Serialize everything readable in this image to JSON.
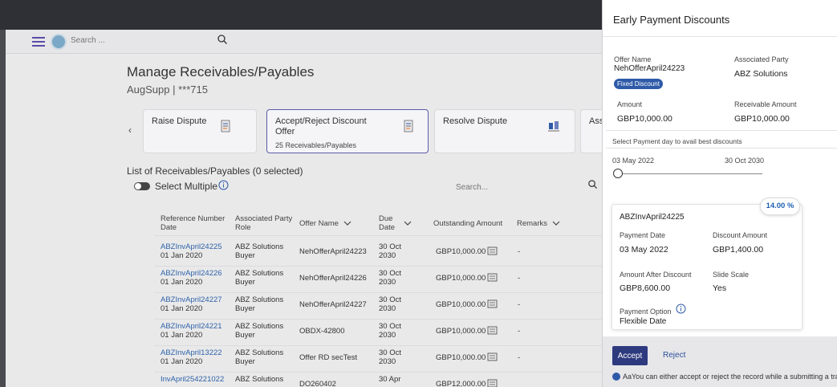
{
  "header": {
    "search_placeholder": "Search ..."
  },
  "page": {
    "title": "Manage Receivables/Payables",
    "subtitle": "AugSupp | ***715"
  },
  "carousel": {
    "cards": [
      {
        "title": "Raise Dispute",
        "count": ""
      },
      {
        "title": "Accept/Reject Discount Offer",
        "count": "25 Receivables/Payables"
      },
      {
        "title": "Resolve Dispute",
        "count": ""
      },
      {
        "title": "Assi",
        "count": ""
      }
    ]
  },
  "list": {
    "title": "List of Receivables/Payables (0 selected)",
    "select_multiple": "Select Multiple",
    "search_placeholder": "Search...",
    "columns": {
      "ref": [
        "Reference Number",
        "Date"
      ],
      "party": [
        "Associated Party",
        "Role"
      ],
      "offer": "Offer Name",
      "due": [
        "Due",
        "Date"
      ],
      "outstanding": "Outstanding Amount",
      "remarks": "Remarks"
    },
    "rows": [
      {
        "ref": "ABZInvApril24225",
        "date": "01 Jan 2020",
        "party": "ABZ Solutions",
        "role": "Buyer",
        "offer": "NehOfferApril24223",
        "due1": "30 Oct",
        "due2": "2030",
        "amount": "GBP10,000.00",
        "remarks": "-"
      },
      {
        "ref": "ABZInvApril24226",
        "date": "01 Jan 2020",
        "party": "ABZ Solutions",
        "role": "Buyer",
        "offer": "NehOfferApril24226",
        "due1": "30 Oct",
        "due2": "2030",
        "amount": "GBP10,000.00",
        "remarks": "-"
      },
      {
        "ref": "ABZInvApril24227",
        "date": "01 Jan 2020",
        "party": "ABZ Solutions",
        "role": "Buyer",
        "offer": "NehOfferApril24227",
        "due1": "30 Oct",
        "due2": "2030",
        "amount": "GBP10,000.00",
        "remarks": "-"
      },
      {
        "ref": "ABZInvApril24221",
        "date": "01 Jan 2020",
        "party": "ABZ Solutions",
        "role": "Buyer",
        "offer": "OBDX-42800",
        "due1": "30 Oct",
        "due2": "2030",
        "amount": "GBP10,000.00",
        "remarks": "-"
      },
      {
        "ref": "ABZInvApril13222",
        "date": "01 Jan 2020",
        "party": "ABZ Solutions",
        "role": "Buyer",
        "offer": "Offer RD secTest",
        "due1": "30 Oct",
        "due2": "2030",
        "amount": "GBP10,000.00",
        "remarks": "-"
      },
      {
        "ref": "InvApril254221022",
        "date": "",
        "party": "ABZ Solutions",
        "role": "",
        "offer": "DO260402",
        "due1": "30 Apr",
        "due2": "",
        "amount": "GBP12,000.00",
        "remarks": ""
      }
    ]
  },
  "panel": {
    "title": "Early Payment Discounts",
    "offer_name_label": "Offer Name",
    "offer_name": "NehOfferApril24223",
    "associated_party_label": "Associated Party",
    "associated_party": "ABZ Solutions",
    "badge": "Fixed Discount",
    "amount_label": "Amount",
    "amount": "GBP10,000.00",
    "receivable_label": "Receivable Amount",
    "receivable": "GBP10,000.00",
    "select_day_label": "Select Payment day to avail best discounts",
    "slider_start": "03 May 2022",
    "slider_end": "30 Oct 2030",
    "slider_position": 0,
    "detail": {
      "percentage": "14.00 %",
      "invoice": "ABZInvApril24225",
      "payment_date_label": "Payment Date",
      "payment_date": "03 May 2022",
      "discount_label": "Discount Amount",
      "discount": "GBP1,400.00",
      "after_label": "Amount After Discount",
      "after": "GBP8,600.00",
      "slide_label": "Slide Scale",
      "slide": "Yes",
      "option_label": "Payment Option",
      "option": "Flexible Date"
    },
    "accept": "Accept",
    "reject": "Reject",
    "note": "AaYou can either accept or reject the record while a submitting a transaction."
  },
  "colors": {
    "topbar": "#2f3035",
    "link": "#2f63a8",
    "accept_button": "#2e3a7e",
    "accent": "#5b5ba8"
  }
}
